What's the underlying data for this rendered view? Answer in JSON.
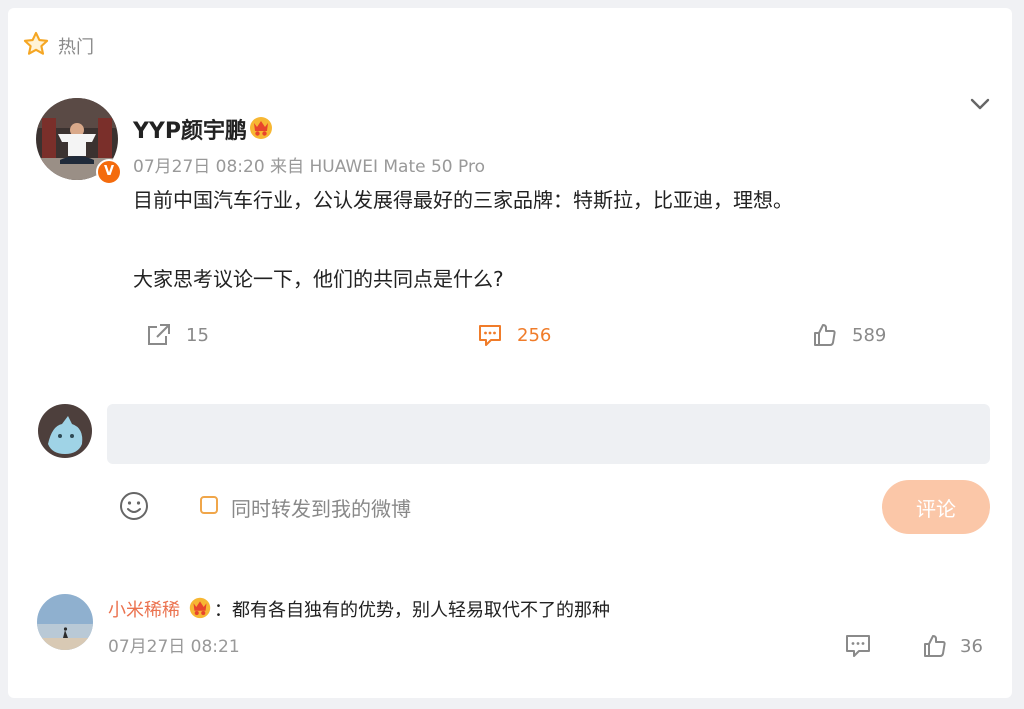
{
  "section": {
    "label": "热门"
  },
  "post": {
    "author": "YYP颜宇鹏",
    "verified_badge": "V",
    "meta": "07月27日 08:20  来自 HUAWEI Mate 50 Pro",
    "paragraphs": [
      "目前中国汽车行业，公认发展得最好的三家品牌：特斯拉，比亚迪，理想。",
      "大家思考议论一下，他们的共同点是什么?"
    ],
    "actions": {
      "repost_count": "15",
      "comment_count": "256",
      "like_count": "589"
    }
  },
  "composer": {
    "input_value": "",
    "repost_label": "同时转发到我的微博",
    "submit_label": "评论"
  },
  "comments": [
    {
      "name": "小米稀稀",
      "text": "：都有各自独有的优势，别人轻易取代不了的那种",
      "time": "07月27日 08:21",
      "like_count": "36"
    }
  ],
  "colors": {
    "accent": "#f07c2a",
    "name_link": "#eb7350",
    "submit_disabled": "#fbc7a8",
    "verified": "#f46b0d",
    "muted": "#999999"
  },
  "icons": {
    "hot": "star-icon",
    "collapse": "chevron-down-icon",
    "repost": "repost-icon",
    "comment": "comment-icon",
    "like": "thumbs-up-icon",
    "emoji": "emoji-icon",
    "vip": "vip-crown-icon"
  }
}
